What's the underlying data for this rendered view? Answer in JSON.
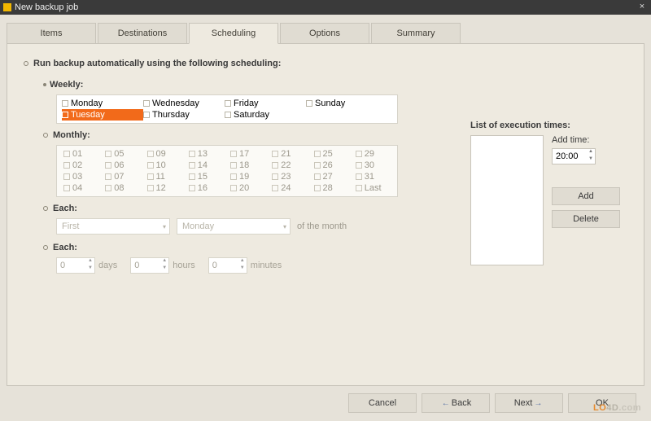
{
  "window": {
    "title": "New backup job",
    "close": "×"
  },
  "tabs": [
    "Items",
    "Destinations",
    "Scheduling",
    "Options",
    "Summary"
  ],
  "active_tab": 2,
  "heading": "Run backup automatically using the following scheduling:",
  "weekly": {
    "label": "Weekly:",
    "days": [
      [
        "Monday",
        "Wednesday",
        "Friday",
        "Sunday"
      ],
      [
        "Tuesday",
        "Thursday",
        "Saturday"
      ]
    ],
    "selected": "Tuesday"
  },
  "monthly": {
    "label": "Monthly:",
    "cells": [
      [
        "01",
        "05",
        "09",
        "13",
        "17",
        "21",
        "25",
        "29"
      ],
      [
        "02",
        "06",
        "10",
        "14",
        "18",
        "22",
        "26",
        "30"
      ],
      [
        "03",
        "07",
        "11",
        "15",
        "19",
        "23",
        "27",
        "31"
      ],
      [
        "04",
        "08",
        "12",
        "16",
        "20",
        "24",
        "28",
        "Last"
      ]
    ]
  },
  "each_month": {
    "label": "Each:",
    "ordinal": "First",
    "day": "Monday",
    "suffix": "of the month"
  },
  "each_interval": {
    "label": "Each:",
    "days": "0",
    "days_unit": "days",
    "hours": "0",
    "hours_unit": "hours",
    "minutes": "0",
    "minutes_unit": "minutes"
  },
  "exec": {
    "title": "List of execution times:",
    "add_label": "Add time:",
    "time_value": "20:00",
    "add_btn": "Add",
    "del_btn": "Delete"
  },
  "footer": {
    "cancel": "Cancel",
    "back": "Back",
    "next": "Next",
    "ok": "OK"
  },
  "watermark": {
    "a": "LO",
    "b": "4D",
    "c": ".com"
  }
}
